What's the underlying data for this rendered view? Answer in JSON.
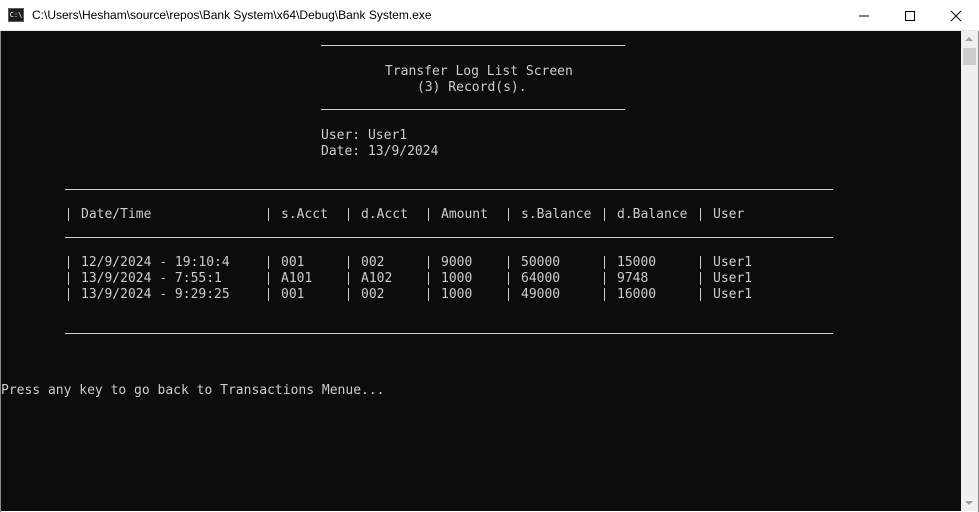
{
  "window": {
    "icon_text": "C:\\",
    "title": "C:\\Users\\Hesham\\source\\repos\\Bank System\\x64\\Debug\\Bank System.exe"
  },
  "console": {
    "screen_title": "Transfer Log List Screen",
    "record_count": "(3) Record(s).",
    "user_line": "User: User1",
    "date_line": "Date: 13/9/2024",
    "table": {
      "headers": [
        "Date/Time",
        "s.Acct",
        "d.Acct",
        "Amount",
        "s.Balance",
        "d.Balance",
        "User"
      ],
      "rows": [
        [
          "12/9/2024 - 19:10:4",
          "001",
          "002",
          "9000",
          "50000",
          "15000",
          "User1"
        ],
        [
          "13/9/2024 - 7:55:1",
          "A101",
          "A102",
          "1000",
          "64000",
          "9748",
          "User1"
        ],
        [
          "13/9/2024 - 9:29:25",
          "001",
          "002",
          "1000",
          "49000",
          "16000",
          "User1"
        ]
      ]
    },
    "footer_prompt": "Press any key to go back to Transactions Menue..."
  }
}
